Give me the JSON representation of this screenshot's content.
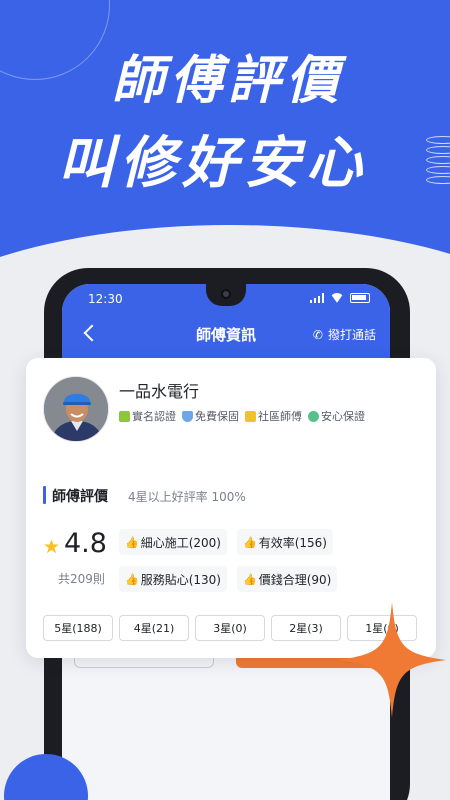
{
  "hero": {
    "line1": "師傅評價",
    "line2": "叫修好安心"
  },
  "status_bar": {
    "time": "12:30"
  },
  "nav": {
    "title": "師傅資訊",
    "call_label": "撥打通話"
  },
  "master": {
    "name": "一品水電行",
    "badges": [
      {
        "label": "實名認證",
        "icon": "id-card-icon",
        "color": "#8cc63f"
      },
      {
        "label": "免費保固",
        "icon": "shield-icon",
        "color": "#6fa7e8"
      },
      {
        "label": "社區師傅",
        "icon": "house-icon",
        "color": "#f2c12e"
      },
      {
        "label": "安心保證",
        "icon": "heart-shield-icon",
        "color": "#58c08a"
      }
    ]
  },
  "reviews": {
    "title": "師傅評價",
    "subtitle": "4星以上好評率 100%",
    "score": "4.8",
    "count": "共209則",
    "tags": [
      "細心施工(200)",
      "有效率(156)",
      "服務貼心(130)",
      "價錢合理(90)"
    ],
    "filters": [
      "5星(188)",
      "4星(21)",
      "3星(0)",
      "2星(3)",
      "1星(0)"
    ]
  },
  "colors": {
    "brand_blue": "#3a63e8",
    "accent_orange": "#f07a33",
    "star_yellow": "#f7c120"
  }
}
